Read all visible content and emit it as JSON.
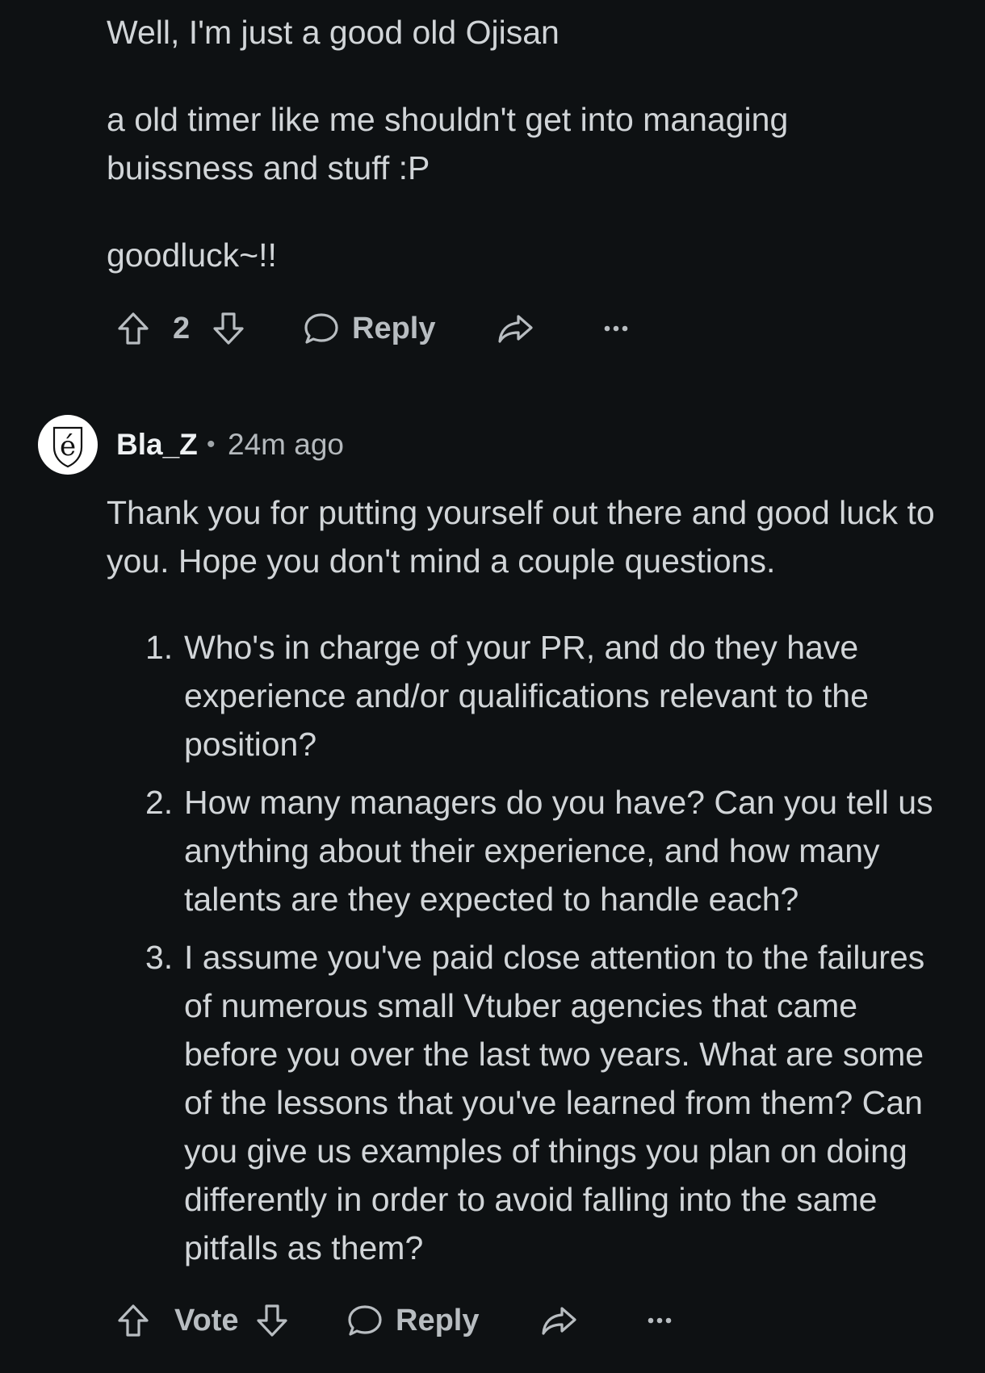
{
  "comment1": {
    "paragraphs": [
      "Well, I'm just a good old Ojisan",
      "a old timer like me shouldn't get into managing buissness and stuff :P",
      "goodluck~!!"
    ],
    "actions": {
      "vote_count": "2",
      "reply_label": "Reply",
      "upvote_icon": "upvote-arrow-icon",
      "downvote_icon": "downvote-arrow-icon",
      "reply_icon": "speech-bubble-icon",
      "share_icon": "share-arrow-icon",
      "more_icon": "ellipsis-icon"
    }
  },
  "comment2": {
    "username": "Bla_Z",
    "separator": "•",
    "timestamp": "24m ago",
    "avatar_glyph": "é",
    "intro": "Thank you for putting yourself out there and good luck to you. Hope you don't mind a couple questions.",
    "list": [
      {
        "num": "1.",
        "text": "Who's in charge of your PR, and do they have experience and/or qualifications relevant to the position?"
      },
      {
        "num": "2.",
        "text": "How many managers do you have? Can you tell us anything about their experience, and how many talents are they expected to handle each?"
      },
      {
        "num": "3.",
        "text": "I assume you've paid close attention to the failures of numerous small Vtuber agencies that came before you over the last two years. What are some of the lessons that you've learned from them? Can you give us examples of things you plan on doing differently in order to avoid falling into the same pitfalls as them?"
      }
    ],
    "actions": {
      "vote_label": "Vote",
      "reply_label": "Reply"
    }
  },
  "colors": {
    "background": "#0e1113",
    "text": "#d1d5d8",
    "muted": "#b8bdc1"
  }
}
